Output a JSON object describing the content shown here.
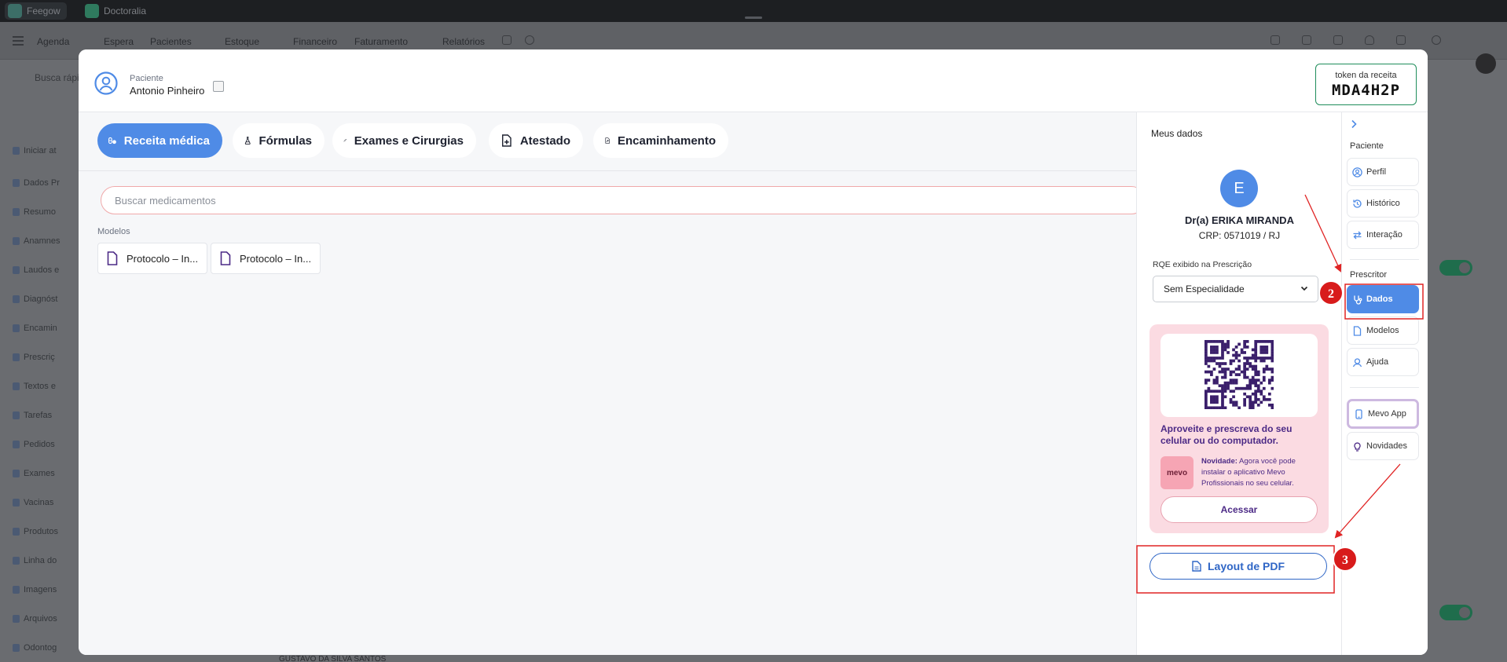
{
  "background_app": {
    "window_tabs": [
      {
        "label": "Feegow"
      },
      {
        "label": "Doctoralia"
      }
    ],
    "nav_items": [
      "Agenda",
      "Espera",
      "Pacientes",
      "Estoque",
      "Financeiro",
      "Faturamento",
      "Relatórios"
    ],
    "search_placeholder": "Busca rápi",
    "sidebar_items": [
      "Iniciar at",
      "Dados Pr",
      "Resumo",
      "Anamnes",
      "Laudos e",
      "Diagnóst",
      "Encamin",
      "Prescriç",
      "Textos e",
      "Tarefas",
      "Pedidos",
      "Exames",
      "Vacinas",
      "Produtos",
      "Linha do",
      "Imagens",
      "Arquivos",
      "Odontog"
    ],
    "bottom_text": "GUSTAVO DA SILVA SANTOS"
  },
  "modal": {
    "patient": {
      "label": "Paciente",
      "name": "Antonio Pinheiro",
      "icon": "user-circle-icon"
    },
    "token": {
      "label": "token da receita",
      "value": "MDA4H2P",
      "border_color": "#1f8d5b"
    },
    "tabs": [
      {
        "label": "Receita médica",
        "icon": "pills-icon",
        "active": true
      },
      {
        "label": "Fórmulas",
        "icon": "flask-icon",
        "active": false
      },
      {
        "label": "Exames e Cirurgias",
        "icon": "syringe-icon",
        "active": false
      },
      {
        "label": "Atestado",
        "icon": "medical-doc-icon",
        "active": false
      },
      {
        "label": "Encaminhamento",
        "icon": "referral-doc-icon",
        "active": false
      }
    ],
    "search": {
      "placeholder": "Buscar medicamentos"
    },
    "modelos": {
      "label": "Modelos",
      "items": [
        {
          "label": "Protocolo – In..."
        },
        {
          "label": "Protocolo – In..."
        }
      ]
    }
  },
  "meus_dados": {
    "title": "Meus dados",
    "avatar_letter": "E",
    "doctor_name": "Dr(a) ERIKA MIRANDA",
    "crp": "CRP: 0571019 / RJ",
    "rqe_label": "RQE exibido na Prescrição",
    "rqe_selected": "Sem Especialidade",
    "promo": {
      "title": "Aproveite e prescreva do seu celular ou do computador.",
      "badge": "mevo",
      "novidade_bold": "Novidade:",
      "novidade_text": " Agora você pode instalar o aplicativo Mevo Profissionais no seu celular.",
      "button": "Acessar"
    },
    "pdf_button": "Layout de PDF"
  },
  "right_nav": {
    "sections": [
      {
        "title": "Paciente",
        "items": [
          {
            "label": "Perfil",
            "icon": "profile-icon"
          },
          {
            "label": "Histórico",
            "icon": "history-icon"
          },
          {
            "label": "Interação",
            "icon": "interaction-icon"
          }
        ]
      },
      {
        "title": "Prescritor",
        "items": [
          {
            "label": "Dados",
            "icon": "prescriber-data-icon",
            "active": true
          },
          {
            "label": "Modelos",
            "icon": "document-icon"
          },
          {
            "label": "Ajuda",
            "icon": "help-icon"
          }
        ]
      }
    ],
    "extra_items": [
      {
        "label": "Mevo App",
        "icon": "phone-icon"
      },
      {
        "label": "Novidades",
        "icon": "lightbulb-icon"
      }
    ]
  },
  "annotations": {
    "markers": [
      "2",
      "3"
    ],
    "color": "#e02424"
  },
  "colors": {
    "accent": "#4f8be6",
    "pdf_blue": "#2f66c6",
    "promo_bg": "#fbdbe2",
    "promo_text": "#4c2a86",
    "search_border": "#f0a9aa"
  }
}
